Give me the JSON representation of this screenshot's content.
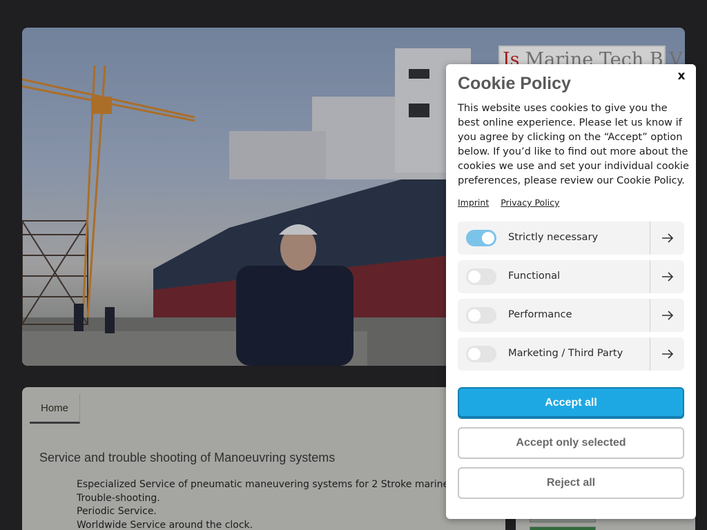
{
  "brand": {
    "logo_prefix": "Is",
    "logo_text": "Marine Tech B.V."
  },
  "nav": {
    "tabs": [
      {
        "label": "Home",
        "active": true
      }
    ]
  },
  "content": {
    "heading": "Service and trouble shooting of Manoeuvring systems",
    "items": [
      "Especialized Service of pneumatic maneuvering systems for 2 Stroke marine",
      "Trouble-shooting.",
      "Periodic Service.",
      "Worldwide Service around the clock."
    ]
  },
  "cookie": {
    "close_label": "x",
    "title": "Cookie Policy",
    "body": "This website uses cookies to give you the best online experience. Please let us know if you agree by clicking on the “Accept” option below. If you’d like to find out more about the cookies we use and set your individual cookie preferences, please review our Cookie Policy.",
    "links": {
      "imprint": "Imprint",
      "privacy": "Privacy Policy"
    },
    "categories": [
      {
        "label": "Strictly necessary",
        "enabled": true
      },
      {
        "label": "Functional",
        "enabled": false
      },
      {
        "label": "Performance",
        "enabled": false
      },
      {
        "label": "Marketing / Third Party",
        "enabled": false
      }
    ],
    "buttons": {
      "accept_all": "Accept all",
      "accept_selected": "Accept only selected",
      "reject_all": "Reject all"
    }
  },
  "colors": {
    "accent": "#1ea8e3",
    "toggle_on": "#7cc3ea",
    "page_bg": "#1f1e20",
    "logo_red": "#a11d21"
  },
  "icons": {
    "category_arrow": "arrow-right-icon",
    "close": "close-icon"
  }
}
